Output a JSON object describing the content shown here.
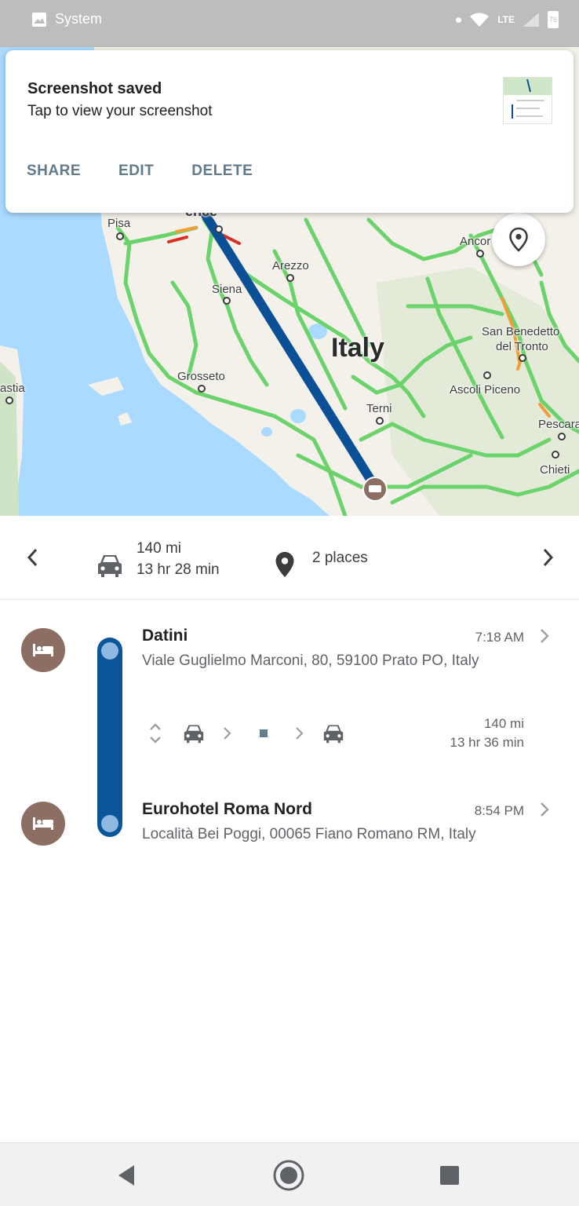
{
  "status_bar": {
    "app_name": "System",
    "network": "LTE",
    "battery": "76",
    "icons": [
      "image-icon",
      "dot-icon",
      "wifi-icon",
      "signal-icon",
      "battery-icon"
    ]
  },
  "notification": {
    "title": "Screenshot saved",
    "body": "Tap to view your screenshot",
    "actions": [
      "SHARE",
      "EDIT",
      "DELETE"
    ]
  },
  "map": {
    "country_label": "Italy",
    "place_labels": {
      "florence": "ence",
      "pisa": "Pisa",
      "arezzo": "Arezzo",
      "siena": "Siena",
      "ancona": "Ancor",
      "san_benedetto_1": "San Benedetto",
      "san_benedetto_2": "del Tronto",
      "grosseto": "Grosseto",
      "ascoli": "Ascoli Piceno",
      "bastia": "astia",
      "terni": "Terni",
      "pescara": "Pescara",
      "chieti": "Chieti"
    },
    "colors": {
      "water": "#aadaff",
      "land": "#f4f1ea",
      "road": "#6bd36b",
      "route": "#0b4f96"
    }
  },
  "summary": {
    "distance": "140 mi",
    "duration": "13 hr 28 min",
    "places": "2 places"
  },
  "itinerary": {
    "stops": [
      {
        "name": "Datini",
        "address": "Viale Guglielmo Marconi, 80, 59100 Prato PO, Italy",
        "time": "7:18 AM"
      },
      {
        "name": "Eurohotel Roma Nord",
        "address": "Località Bei Poggi, 00065 Fiano Romano RM, Italy",
        "time": "8:54 PM"
      }
    ],
    "leg": {
      "distance": "140 mi",
      "duration": "13 hr 36 min"
    }
  },
  "nav_bar": {
    "buttons": [
      "back-icon",
      "home-icon",
      "recents-icon"
    ]
  }
}
